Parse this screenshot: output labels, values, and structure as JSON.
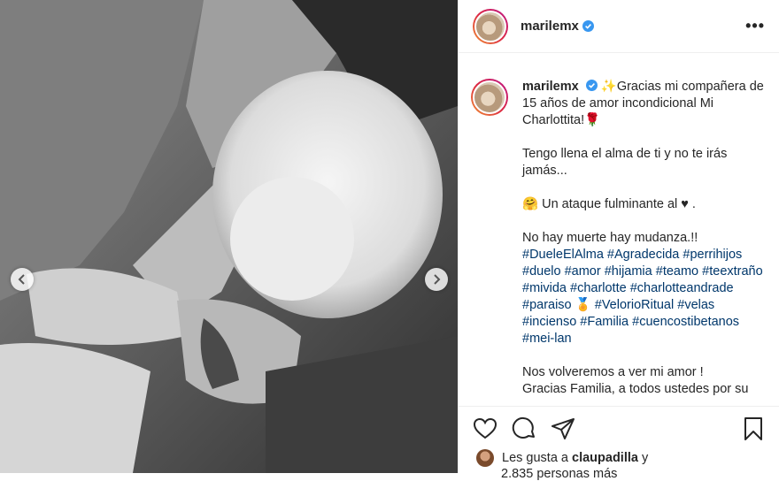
{
  "profile": {
    "username": "marilemx"
  },
  "header": {
    "more_label": "•••"
  },
  "caption": {
    "username": "marilemx",
    "lines": [
      "Gracias mi compañera de 15 años de amor incondicional Mi Charlottita!",
      "Tengo llena el alma de ti y no te irás jamás...",
      "Un ataque fulminante al ♥ .",
      "No hay muerte hay mudanza.!!"
    ],
    "hashtags": [
      "#DueleElAlma",
      "#Agradecida",
      "#perrihijos",
      "#duelo",
      "#amor",
      "#hijamia",
      "#teamo",
      "#teextraño",
      "#mivida",
      "#charlotte",
      "#charlotteandrade",
      "#paraiso",
      "#VelorioRitual",
      "#velas",
      "#incienso",
      "#Familia",
      "#cuencostibetanos",
      "#mei-lan"
    ],
    "closing_1": "Nos volveremos a ver mi amor !",
    "closing_2": "Gracias Familia, a todos ustedes por su"
  },
  "likes": {
    "prefix": "Les gusta a",
    "user": "claupadilla",
    "suffix": "y",
    "count_text": "2.835 personas más"
  },
  "icons": {
    "like": "heart-icon",
    "comment": "comment-icon",
    "share": "share-icon",
    "save": "bookmark-icon",
    "prev": "chevron-left-icon",
    "next": "chevron-right-icon",
    "verified": "verified-badge-icon"
  },
  "colors": {
    "link": "#00376b",
    "verified": "#3897f0",
    "text": "#262626"
  }
}
